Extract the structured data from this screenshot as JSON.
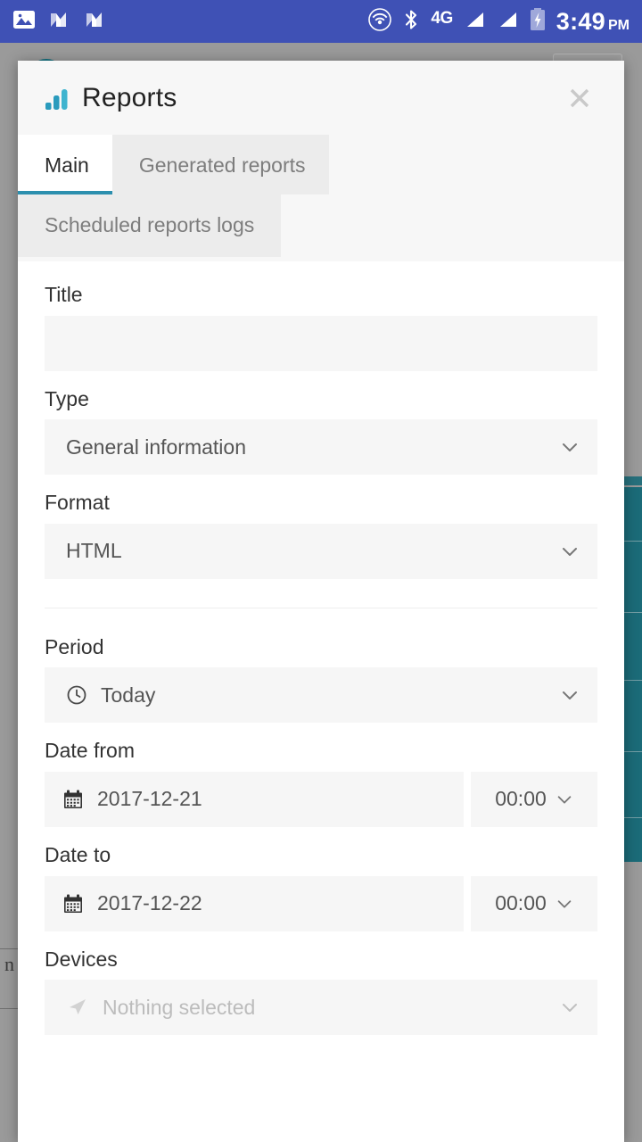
{
  "statusbar": {
    "icons_left": [
      "photo-icon",
      "app-n-icon",
      "app-n-icon"
    ],
    "icons_right": [
      "cast-icon",
      "bluetooth-icon",
      "signal-icon",
      "signal-icon",
      "battery-charging-icon"
    ],
    "network": "4G",
    "time": "3:49",
    "ampm": "PM"
  },
  "background": {
    "title_text": "▬▬ ▪▪▪▪▪ ▬▬▬",
    "logo_icon": "teal-circle-logo"
  },
  "dialog": {
    "title": "Reports",
    "title_icon": "bar-chart-icon",
    "close_icon": "close-icon",
    "tabs": [
      {
        "label": "Main",
        "active": true
      },
      {
        "label": "Generated reports",
        "active": false
      },
      {
        "label": "Scheduled reports logs",
        "active": false
      }
    ],
    "fields": {
      "title": {
        "label": "Title",
        "value": "",
        "placeholder": ""
      },
      "type": {
        "label": "Type",
        "value": "General information",
        "chevron_icon": "chevron-down-icon"
      },
      "format": {
        "label": "Format",
        "value": "HTML",
        "chevron_icon": "chevron-down-icon"
      },
      "period": {
        "label": "Period",
        "value": "Today",
        "lead_icon": "clock-icon",
        "chevron_icon": "chevron-down-icon"
      },
      "date_from": {
        "label": "Date from",
        "value": "2017-12-21",
        "lead_icon": "calendar-icon",
        "time": "00:00",
        "chevron_icon": "chevron-down-icon"
      },
      "date_to": {
        "label": "Date to",
        "value": "2017-12-22",
        "lead_icon": "calendar-icon",
        "time": "00:00",
        "chevron_icon": "chevron-down-icon"
      },
      "devices": {
        "label": "Devices",
        "value": "Nothing selected",
        "lead_icon": "navigation-arrow-icon",
        "chevron_icon": "chevron-down-icon"
      }
    }
  },
  "colors": {
    "statusbar_bg": "#3f51b5",
    "accent_teal": "#2c8fae",
    "chart_icon": "#2a9bbd",
    "dialog_bg": "#ffffff",
    "control_bg": "#f6f6f6",
    "backdrop": "#8a8a8a",
    "bg_teal_panel": "#1b6b78"
  }
}
